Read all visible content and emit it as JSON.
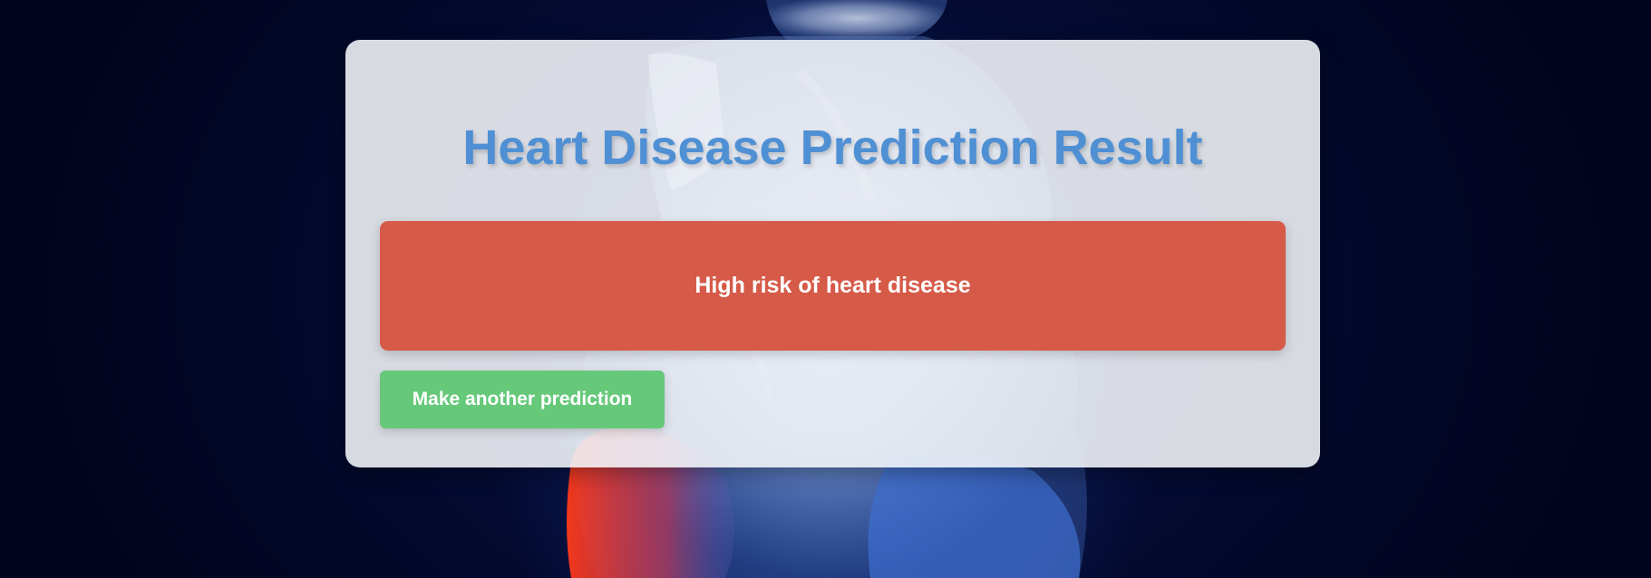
{
  "page": {
    "title": "Heart Disease Prediction Result"
  },
  "result": {
    "message": "High risk of heart disease",
    "color": "#d65a48"
  },
  "actions": {
    "another_prediction_label": "Make another prediction",
    "button_color": "#66c97a"
  },
  "theme": {
    "title_color": "#4f90d4",
    "background": "#020622",
    "background_image": "x-ray heart illustration"
  }
}
